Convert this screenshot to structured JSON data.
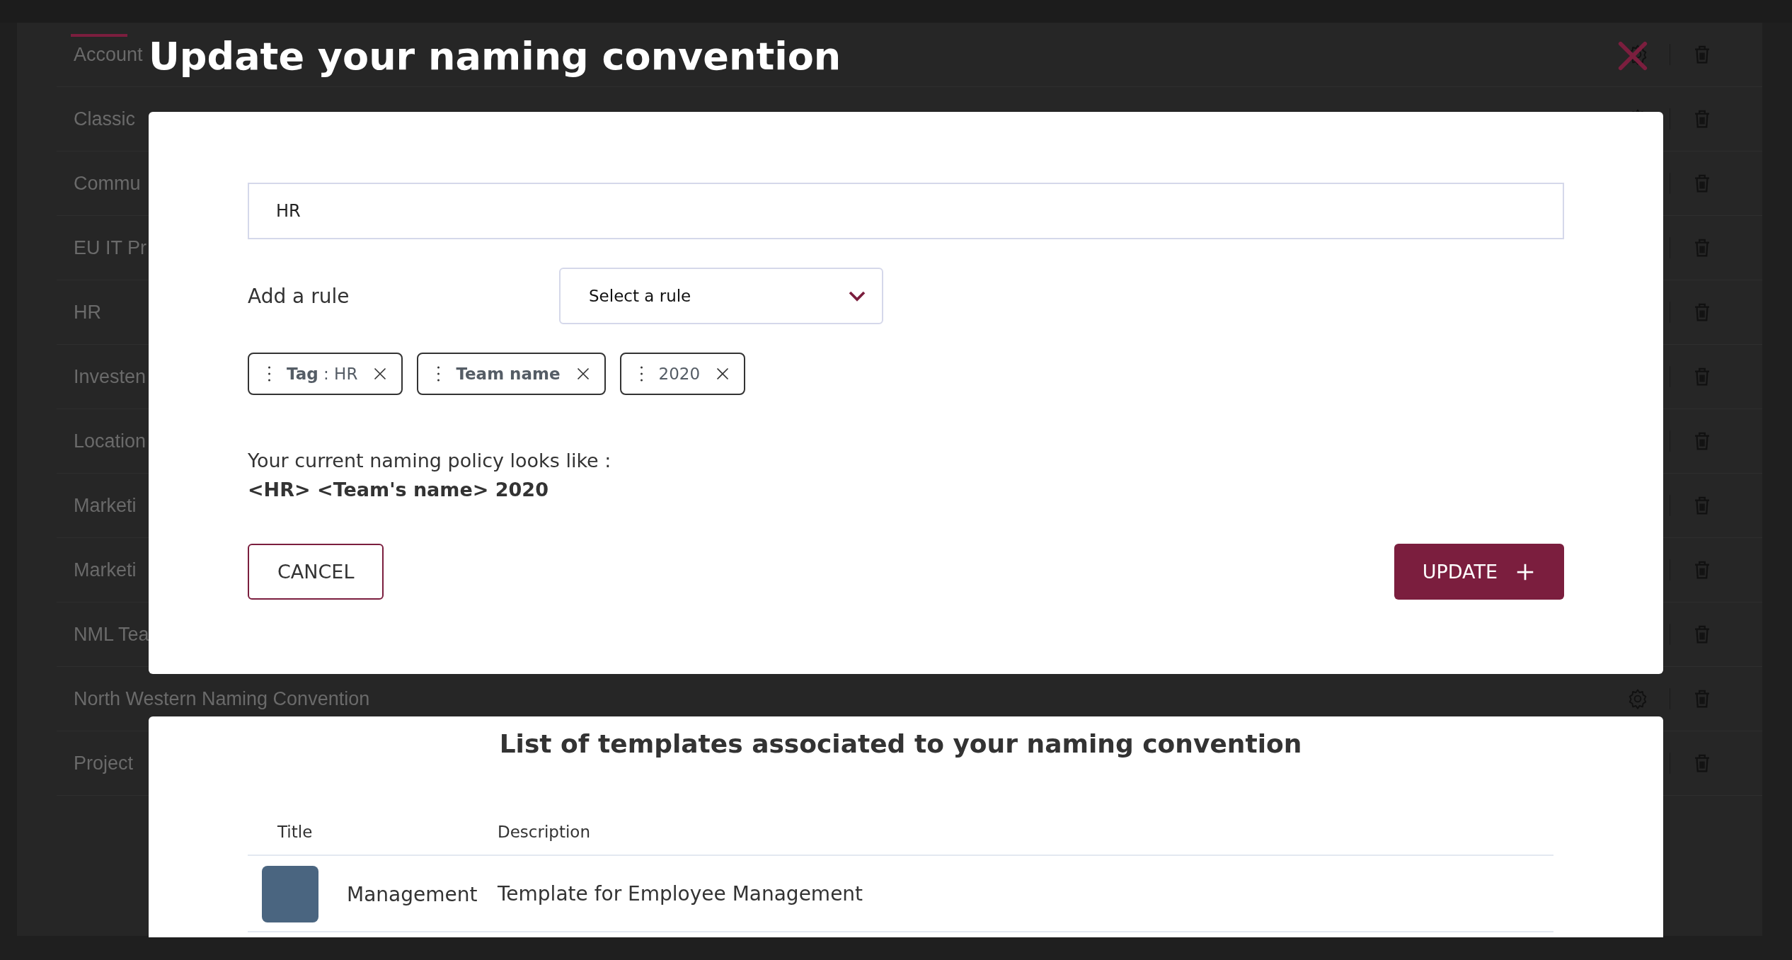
{
  "background_list": {
    "rows": [
      {
        "name": "Account"
      },
      {
        "name": "Classic"
      },
      {
        "name": "Commu"
      },
      {
        "name": "EU IT Pr"
      },
      {
        "name": "HR"
      },
      {
        "name": "Investen"
      },
      {
        "name": "Location"
      },
      {
        "name": "Marketi"
      },
      {
        "name": "Marketi"
      },
      {
        "name": "NML Tea"
      },
      {
        "name": "North Western Naming Convention"
      },
      {
        "name": "Project"
      }
    ]
  },
  "modal": {
    "title": "Update your naming convention",
    "name_field": {
      "value": "HR"
    },
    "rule": {
      "label": "Add a rule",
      "placeholder": "Select a rule"
    },
    "chips": [
      {
        "kind": "tag",
        "label": "**Tag** : HR"
      },
      {
        "kind": "field",
        "label": "Team name"
      },
      {
        "kind": "text",
        "label": "2020"
      }
    ],
    "policy": {
      "intro": "Your current naming policy looks like :",
      "preview": "<HR> <Team's name> 2020"
    },
    "buttons": [
      {
        "kind": "secondary",
        "label": "CANCEL"
      },
      {
        "kind": "primary",
        "label": "UPDATE"
      }
    ]
  },
  "templates": {
    "heading": "List of templates associated to your naming convention",
    "columns": [
      "Title",
      "Description"
    ],
    "rows": [
      {
        "title": "Management",
        "description": "Template for Employee Management"
      }
    ]
  }
}
